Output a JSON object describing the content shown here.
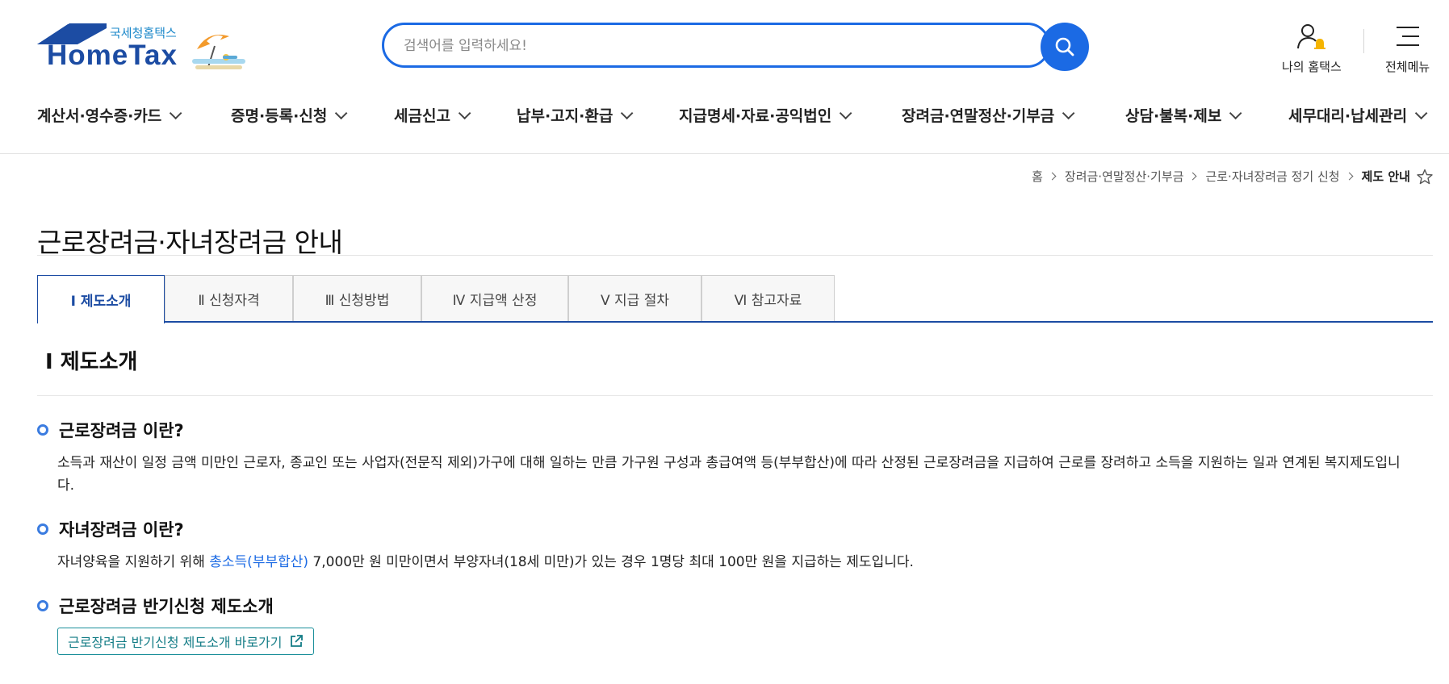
{
  "header": {
    "logo_sub": "국세청홈택스",
    "logo_main": "HomeTax",
    "search_placeholder": "검색어를 입력하세요!",
    "my_hometax_label": "나의 홈택스",
    "all_menu_label": "전체메뉴"
  },
  "gnb": {
    "items": [
      {
        "label": "계산서·영수증·카드"
      },
      {
        "label": "증명·등록·신청"
      },
      {
        "label": "세금신고"
      },
      {
        "label": "납부·고지·환급"
      },
      {
        "label": "지급명세·자료·공익법인"
      },
      {
        "label": "장려금·연말정산·기부금"
      },
      {
        "label": "상담·불복·제보"
      },
      {
        "label": "세무대리·납세관리"
      }
    ]
  },
  "breadcrumb": {
    "items": [
      "홈",
      "장려금·연말정산·기부금",
      "근로·자녀장려금 정기 신청"
    ],
    "current": "제도 안내"
  },
  "page": {
    "title": "근로장려금·자녀장려금 안내"
  },
  "tabs": [
    {
      "label": "Ⅰ 제도소개",
      "active": true
    },
    {
      "label": "Ⅱ 신청자격",
      "active": false
    },
    {
      "label": "Ⅲ 신청방법",
      "active": false
    },
    {
      "label": "Ⅳ 지급액 산정",
      "active": false
    },
    {
      "label": "Ⅴ 지급 절차",
      "active": false
    },
    {
      "label": "Ⅵ  참고자료",
      "active": false
    }
  ],
  "content": {
    "section_title": "Ⅰ 제도소개",
    "blocks": {
      "work_incentive": {
        "heading": "근로장려금 이란?",
        "body": "소득과 재산이 일정 금액 미만인 근로자, 종교인 또는 사업자(전문직 제외)가구에 대해 일하는 만큼 가구원 구성과 총급여액 등(부부합산)에 따라 산정된 근로장려금을 지급하여 근로를 장려하고 소득을 지원하는 일과 연계된 복지제도입니다."
      },
      "child_incentive": {
        "heading": "자녀장려금 이란?",
        "body_before": "자녀양육을 지원하기 위해 ",
        "body_link": "총소득(부부합산)",
        "body_after": " 7,000만 원 미만이면서 부양자녀(18세 미만)가 있는 경우 1명당 최대 100만 원을 지급하는 제도입니다."
      },
      "semiannual": {
        "heading": "근로장려금 반기신청 제도소개",
        "button_label": "근로장려금 반기신청 제도소개 바로가기"
      }
    }
  },
  "colors": {
    "brand_blue": "#1b6ae4",
    "navy": "#1c4ca3",
    "teal": "#137c86",
    "bell_yellow": "#f5b400"
  }
}
